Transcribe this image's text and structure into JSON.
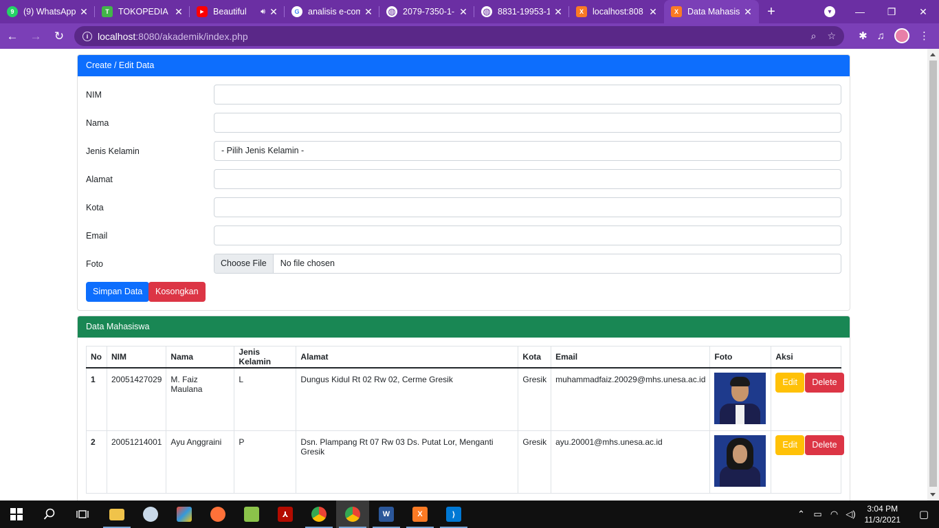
{
  "browser": {
    "tabs": [
      {
        "title": "(9) WhatsApp",
        "favicon": "whatsapp-icon",
        "color": "#25d366",
        "glyph": "9"
      },
      {
        "title": "TOKOPEDIA",
        "favicon": "tokopedia-icon",
        "color": "#42b549",
        "glyph": "T"
      },
      {
        "title": "Beautiful",
        "favicon": "youtube-icon",
        "color": "#ff0000",
        "glyph": "▶"
      },
      {
        "title": "analisis e-com",
        "favicon": "google-icon",
        "color": "#ffffff",
        "glyph": "G"
      },
      {
        "title": "2079-7350-1-",
        "favicon": "globe-icon",
        "color": "#ffffff",
        "glyph": "◍"
      },
      {
        "title": "8831-19953-1",
        "favicon": "globe-icon",
        "color": "#ffffff",
        "glyph": "◍"
      },
      {
        "title": "localhost:808",
        "favicon": "xampp-icon",
        "color": "#fb7a24",
        "glyph": "X"
      },
      {
        "title": "Data Mahasisw",
        "favicon": "xampp-icon",
        "color": "#fb7a24",
        "glyph": "X"
      }
    ],
    "url_host": "localhost",
    "url_path": ":8080/akademik/index.php"
  },
  "form": {
    "header": "Create / Edit Data",
    "fields": {
      "nim": "NIM",
      "nama": "Nama",
      "jk": "Jenis Kelamin",
      "alamat": "Alamat",
      "kota": "Kota",
      "email": "Email",
      "foto": "Foto"
    },
    "jk_selected": "- Pilih Jenis Kelamin -",
    "file_button": "Choose File",
    "file_status": "No file chosen",
    "save_label": "Simpan Data",
    "reset_label": "Kosongkan"
  },
  "list": {
    "header": "Data Mahasiswa",
    "columns": [
      "No",
      "NIM",
      "Nama",
      "Jenis Kelamin",
      "Alamat",
      "Kota",
      "Email",
      "Foto",
      "Aksi"
    ],
    "rows": [
      {
        "no": "1",
        "nim": "20051427029",
        "nama": "M. Faiz Maulana",
        "jk": "L",
        "alamat": "Dungus Kidul Rt 02 Rw 02, Cerme Gresik",
        "kota": "Gresik",
        "email": "muhammadfaiz.20029@mhs.unesa.ac.id"
      },
      {
        "no": "2",
        "nim": "20051214001",
        "nama": "Ayu Anggraini",
        "jk": "P",
        "alamat": "Dsn. Plampang Rt 07 Rw 03 Ds. Putat Lor, Menganti Gresik",
        "kota": "Gresik",
        "email": "ayu.20001@mhs.unesa.ac.id"
      }
    ],
    "edit_label": "Edit",
    "delete_label": "Delete"
  },
  "taskbar": {
    "time": "3:04 PM",
    "date": "11/3/2021"
  }
}
